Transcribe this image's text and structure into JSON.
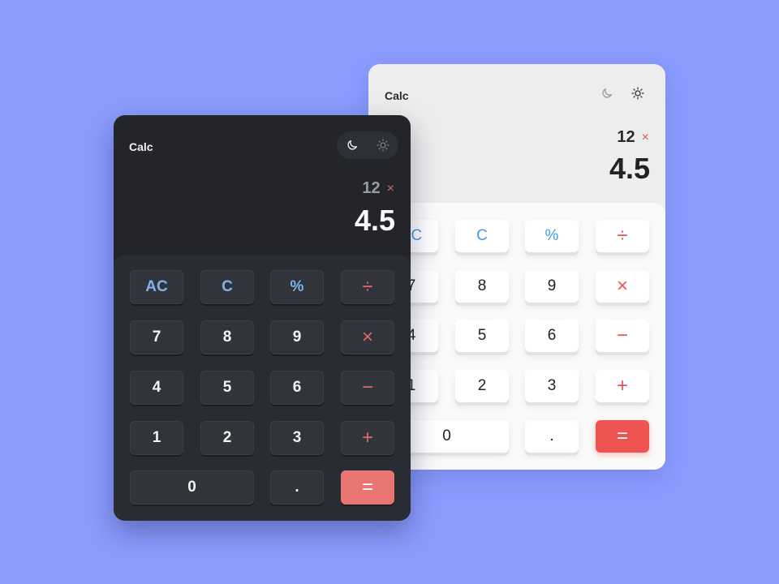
{
  "theme_colors": {
    "background": "#8b9cff",
    "accent_red": "#ee5552",
    "accent_blue": "#3a9de8"
  },
  "light_calc": {
    "title": "Calc",
    "expression": "12",
    "operator": "×",
    "result": "4.5",
    "keys": {
      "ac": "AC",
      "c": "C",
      "percent": "%",
      "divide": "÷",
      "k7": "7",
      "k8": "8",
      "k9": "9",
      "multiply": "×",
      "k4": "4",
      "k5": "5",
      "k6": "6",
      "minus": "−",
      "k1": "1",
      "k2": "2",
      "k3": "3",
      "plus": "+",
      "k0": "0",
      "dot": ".",
      "equals": "="
    }
  },
  "dark_calc": {
    "title": "Calc",
    "expression": "12",
    "operator": "×",
    "result": "4.5",
    "keys": {
      "ac": "AC",
      "c": "C",
      "percent": "%",
      "divide": "÷",
      "k7": "7",
      "k8": "8",
      "k9": "9",
      "multiply": "×",
      "k4": "4",
      "k5": "5",
      "k6": "6",
      "minus": "−",
      "k1": "1",
      "k2": "2",
      "k3": "3",
      "plus": "+",
      "k0": "0",
      "dot": ".",
      "equals": "="
    }
  }
}
